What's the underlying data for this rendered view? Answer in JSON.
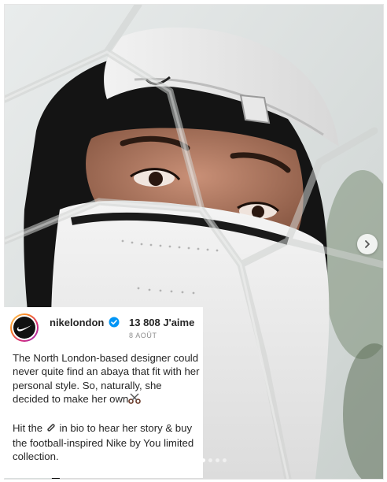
{
  "post": {
    "image_alt": "Person wearing a white Nike cap, black hijab and white face covering, seen through a blurred net",
    "carousel": {
      "next_icon": "chevron-right-icon",
      "slide_count": 4,
      "active_slide": 1
    },
    "author": {
      "username": "nikelondon",
      "verified_icon": "verified-badge-icon",
      "avatar_icon": "nike-swoosh-icon"
    },
    "likes": "13 808 J'aime",
    "date": "8 AOÛT",
    "caption": {
      "para1": "The North London-based designer could never quite find an abaya that fit with her personal style. So, naturally, she decided to make her own",
      "para1_emoji": "scissors-icon",
      "para2_before": "Hit the",
      "para2_emoji": "paperclip-icon",
      "para2_after": "in bio to hear her story & buy the football-inspired Nike by You limited collection."
    }
  },
  "colors": {
    "text": "#262626",
    "muted": "#8e8e8e",
    "verified": "#0095f6"
  }
}
